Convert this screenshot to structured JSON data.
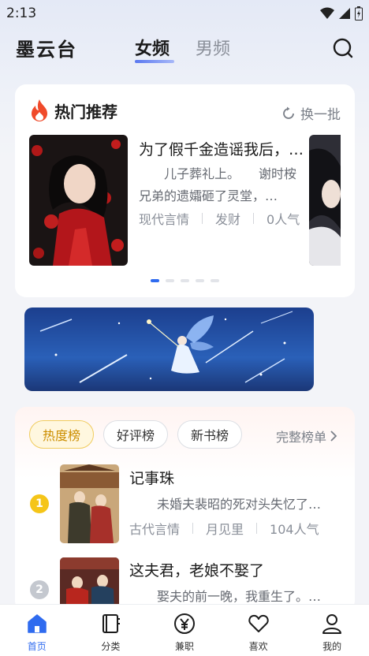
{
  "status_bar": {
    "time": "2:13"
  },
  "header": {
    "app_name": "墨云台",
    "tabs": [
      {
        "label": "女频",
        "active": true
      },
      {
        "label": "男频",
        "active": false
      }
    ]
  },
  "hot": {
    "title": "热门推荐",
    "refresh_label": "换一批",
    "book": {
      "title": "为了假千金造谣我后，…",
      "desc": "　　儿子葬礼上。　　谢时桉兄弟的遗孀砸了灵堂，…",
      "genre": "现代言情",
      "author": "发财",
      "popularity": "0人气"
    },
    "carousel_pages": 5,
    "carousel_active": 0
  },
  "ranking": {
    "tabs": [
      {
        "label": "热度榜",
        "active": true
      },
      {
        "label": "好评榜",
        "active": false
      },
      {
        "label": "新书榜",
        "active": false
      }
    ],
    "all_label": "完整榜单",
    "items": [
      {
        "rank": "1",
        "title": "记事珠",
        "desc": "未婚夫裴昭的死对头失忆了…",
        "genre": "古代言情",
        "author": "月见里",
        "popularity": "104人气"
      },
      {
        "rank": "2",
        "title": "这夫君，老娘不娶了",
        "desc": "娶夫的前一晚，我重生了。…"
      }
    ]
  },
  "bottom_nav": [
    {
      "label": "首页",
      "icon": "home-icon",
      "active": true
    },
    {
      "label": "分类",
      "icon": "book-icon",
      "active": false
    },
    {
      "label": "兼职",
      "icon": "yen-icon",
      "active": false
    },
    {
      "label": "喜欢",
      "icon": "heart-icon",
      "active": false
    },
    {
      "label": "我的",
      "icon": "user-icon",
      "active": false
    }
  ],
  "colors": {
    "accent": "#2f6bef",
    "rank_gold": "#f5c518",
    "rank_silver": "#c4c8cf",
    "hot_fire": "#f04a2a"
  }
}
